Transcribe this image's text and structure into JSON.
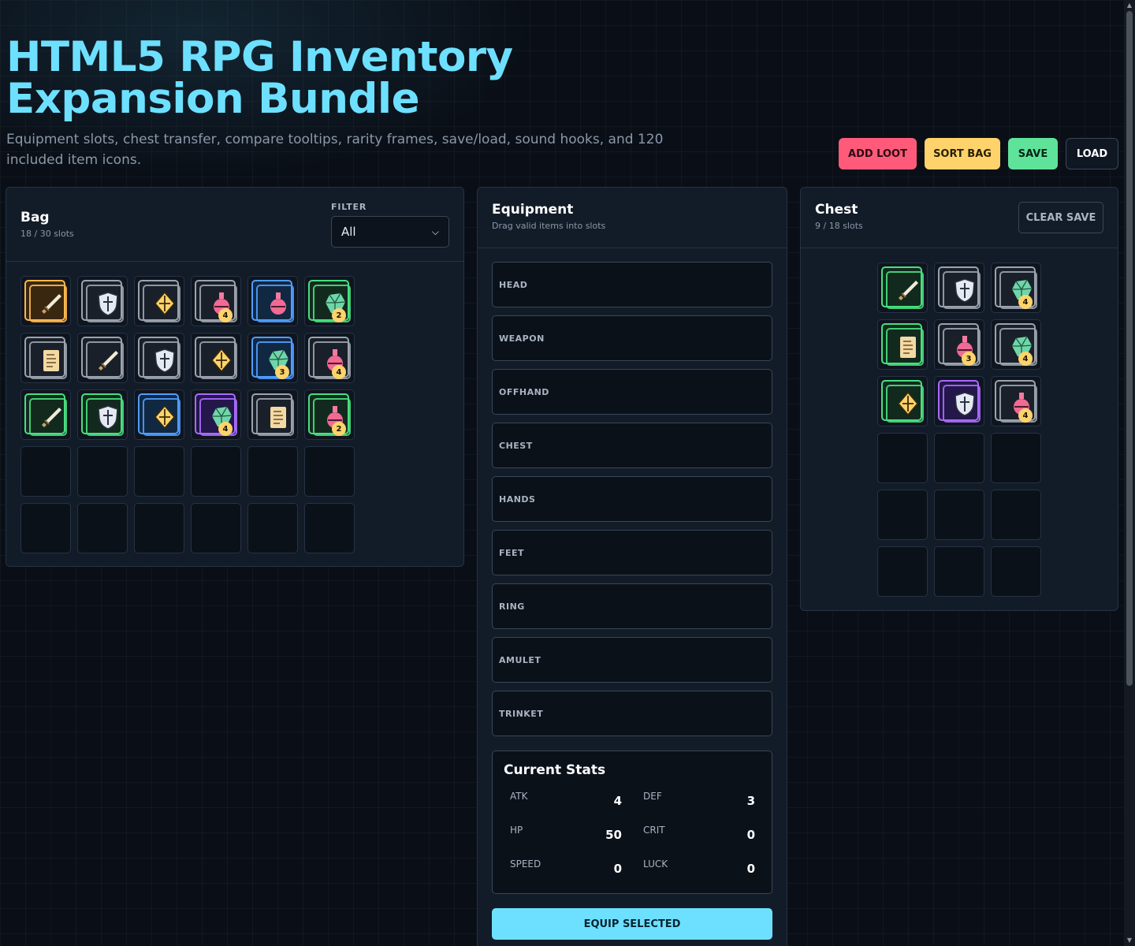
{
  "header": {
    "title": "HTML5 RPG Inventory Expansion Bundle",
    "subtitle": "Equipment slots, chest transfer, compare tooltips, rarity frames, save/load, sound hooks, and 120 included item icons."
  },
  "actions": {
    "add_loot": "ADD LOOT",
    "sort_bag": "SORT BAG",
    "save": "SAVE",
    "load": "LOAD"
  },
  "colors": {
    "accent": "#6ee0ff",
    "add_loot": "#ff5a7a",
    "sort_bag": "#ffd36b",
    "save": "#5fe39a",
    "badge": "#ffd36b"
  },
  "bag": {
    "title": "Bag",
    "slots_text": "18 / 30 slots",
    "filter_label": "FILTER",
    "filter_value": "All",
    "items": [
      {
        "icon": "sword-icon",
        "rarity": "legendary"
      },
      {
        "icon": "shield-icon",
        "rarity": "common"
      },
      {
        "icon": "amulet-icon",
        "rarity": "common"
      },
      {
        "icon": "potion-icon",
        "rarity": "common",
        "qty": "4"
      },
      {
        "icon": "potion-icon",
        "rarity": "rare"
      },
      {
        "icon": "gem-icon",
        "rarity": "uncommon",
        "qty": "2"
      },
      {
        "icon": "scroll-icon",
        "rarity": "common"
      },
      {
        "icon": "sword-icon",
        "rarity": "common"
      },
      {
        "icon": "shield-icon",
        "rarity": "common"
      },
      {
        "icon": "amulet-icon",
        "rarity": "common"
      },
      {
        "icon": "gem-icon",
        "rarity": "rare",
        "qty": "3"
      },
      {
        "icon": "potion-icon",
        "rarity": "common",
        "qty": "4"
      },
      {
        "icon": "sword-icon",
        "rarity": "uncommon"
      },
      {
        "icon": "shield-icon",
        "rarity": "uncommon"
      },
      {
        "icon": "amulet-icon",
        "rarity": "rare"
      },
      {
        "icon": "gem-icon",
        "rarity": "epic",
        "qty": "4"
      },
      {
        "icon": "scroll-icon",
        "rarity": "common"
      },
      {
        "icon": "potion-icon",
        "rarity": "uncommon",
        "qty": "2"
      }
    ],
    "empty_slots": 12
  },
  "equipment": {
    "title": "Equipment",
    "subtitle": "Drag valid items into slots",
    "slots": [
      "HEAD",
      "WEAPON",
      "OFFHAND",
      "CHEST",
      "HANDS",
      "FEET",
      "RING",
      "AMULET",
      "TRINKET"
    ],
    "stats_title": "Current Stats",
    "stats": [
      {
        "label": "ATK",
        "value": "4"
      },
      {
        "label": "DEF",
        "value": "3"
      },
      {
        "label": "HP",
        "value": "50"
      },
      {
        "label": "CRIT",
        "value": "0"
      },
      {
        "label": "SPEED",
        "value": "0"
      },
      {
        "label": "LUCK",
        "value": "0"
      }
    ],
    "equip_button": "EQUIP SELECTED"
  },
  "chest": {
    "title": "Chest",
    "slots_text": "9 / 18 slots",
    "clear_button": "CLEAR SAVE",
    "items": [
      {
        "icon": "sword-icon",
        "rarity": "uncommon"
      },
      {
        "icon": "shield-icon",
        "rarity": "common"
      },
      {
        "icon": "gem-icon",
        "rarity": "common",
        "qty": "4"
      },
      {
        "icon": "scroll-icon",
        "rarity": "uncommon"
      },
      {
        "icon": "potion-icon",
        "rarity": "common",
        "qty": "3"
      },
      {
        "icon": "gem-icon",
        "rarity": "common",
        "qty": "4"
      },
      {
        "icon": "amulet-icon",
        "rarity": "uncommon"
      },
      {
        "icon": "shield-icon",
        "rarity": "epic"
      },
      {
        "icon": "potion-icon",
        "rarity": "common",
        "qty": "4"
      }
    ],
    "empty_slots": 9
  }
}
